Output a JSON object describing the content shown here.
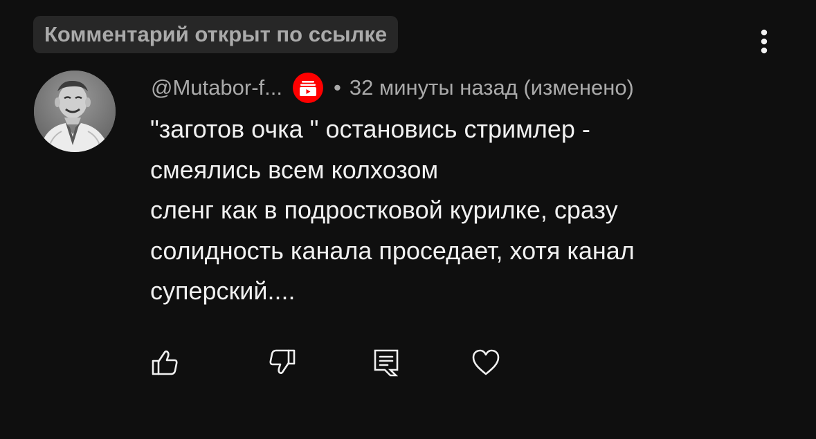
{
  "linked_comment_label": "Комментарий открыт по ссылке",
  "comment": {
    "author": "@Mutabor-f...",
    "separator": "•",
    "timestamp": "32 минуты назад (изменено)",
    "lines": [
      "\"заготов очка \" остановись стримлер -",
      "смеялись всем колхозом",
      "сленг как в подростковой курилке, сразу",
      "солидность канала проседает, хотя канал",
      "суперский...."
    ]
  },
  "colors": {
    "background": "#0f0f0f",
    "badge_background": "#272727",
    "secondary_text": "#aaaaaa",
    "primary_text": "#f1f1f1",
    "brand_red": "#ff0000"
  },
  "icons": {
    "menu": "more-vert-icon",
    "channel_badge": "channel-badge-icon",
    "like": "thumb-up-icon",
    "dislike": "thumb-down-icon",
    "reply": "reply-icon",
    "heart": "heart-icon"
  }
}
